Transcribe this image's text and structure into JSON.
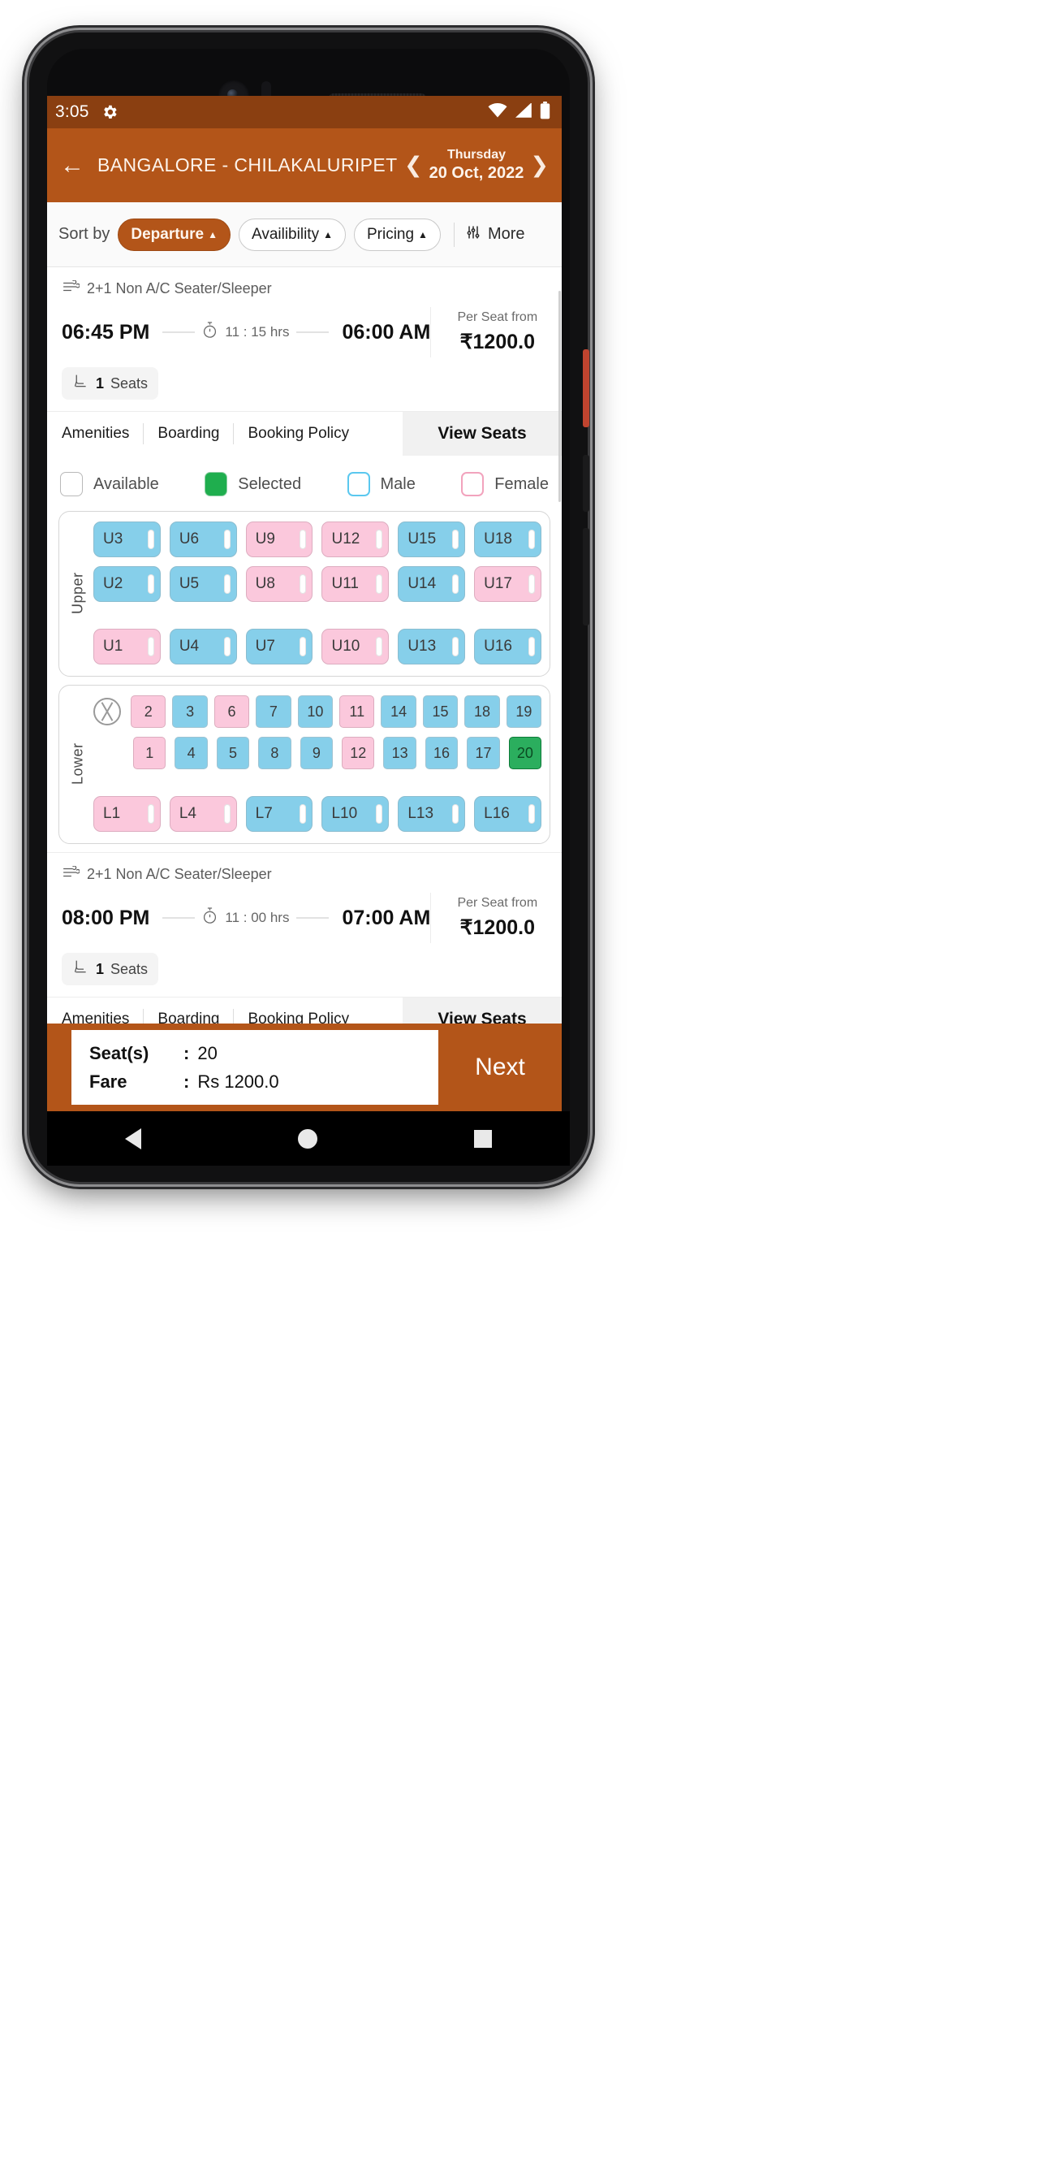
{
  "status_bar": {
    "time": "3:05",
    "gear_icon": "gear-icon",
    "wifi_icon": "wifi-icon",
    "signal_icon": "signal-icon",
    "battery_icon": "battery-icon"
  },
  "app_bar": {
    "back_icon": "arrow-left-icon",
    "route": "BANGALORE - CHILAKALURIPET",
    "prev_icon": "chevron-left-icon",
    "next_icon": "chevron-right-icon",
    "day_of_week": "Thursday",
    "date": "20 Oct, 2022"
  },
  "sort_bar": {
    "label": "Sort by",
    "chips": [
      {
        "label": "Departure",
        "caret": "▲",
        "active": true
      },
      {
        "label": "Availibility",
        "caret": "▲",
        "active": false
      },
      {
        "label": "Pricing",
        "caret": "▲",
        "active": false
      }
    ],
    "more_icon": "filter-icon",
    "more_label": "More"
  },
  "legend": {
    "items": [
      {
        "label": "Available",
        "state": "available"
      },
      {
        "label": "Selected",
        "state": "selected"
      },
      {
        "label": "Male",
        "state": "male"
      },
      {
        "label": "Female",
        "state": "female"
      }
    ]
  },
  "buses": [
    {
      "type_icon": "bus-seat-icon",
      "type": "2+1 Non A/C Seater/Sleeper",
      "departure": "06:45 PM",
      "duration_icon": "stopwatch-icon",
      "duration": "11 : 15 hrs",
      "arrival": "06:00 AM",
      "seat_icon": "seat-icon",
      "seats_count": "1",
      "seats_word": "Seats",
      "price_label": "Per Seat from",
      "price": "₹1200.0",
      "actions": [
        "Amenities",
        "Boarding",
        "Booking Policy"
      ],
      "view_seats": "View Seats",
      "expanded": true,
      "decks": [
        {
          "name": "Upper",
          "type": "sleeper",
          "rows": [
            [
              {
                "label": "U3",
                "color": "blue"
              },
              {
                "label": "U6",
                "color": "blue"
              },
              {
                "label": "U9",
                "color": "pink"
              },
              {
                "label": "U12",
                "color": "pink"
              },
              {
                "label": "U15",
                "color": "blue"
              },
              {
                "label": "U18",
                "color": "blue"
              }
            ],
            [
              {
                "label": "U2",
                "color": "blue"
              },
              {
                "label": "U5",
                "color": "blue"
              },
              {
                "label": "U8",
                "color": "pink"
              },
              {
                "label": "U11",
                "color": "pink"
              },
              {
                "label": "U14",
                "color": "blue"
              },
              {
                "label": "U17",
                "color": "pink"
              }
            ],
            [
              {
                "label": "U1",
                "color": "pink"
              },
              {
                "label": "U4",
                "color": "blue"
              },
              {
                "label": "U7",
                "color": "blue"
              },
              {
                "label": "U10",
                "color": "pink"
              },
              {
                "label": "U13",
                "color": "blue"
              },
              {
                "label": "U16",
                "color": "blue"
              }
            ]
          ]
        },
        {
          "name": "Lower",
          "type": "seater",
          "wheel_icon": "steering-wheel-icon",
          "rows": [
            [
              {
                "label": "2",
                "color": "pink"
              },
              {
                "label": "3",
                "color": "blue"
              },
              {
                "label": "6",
                "color": "pink"
              },
              {
                "label": "7",
                "color": "blue"
              },
              {
                "label": "10",
                "color": "blue"
              },
              {
                "label": "11",
                "color": "pink"
              },
              {
                "label": "14",
                "color": "blue"
              },
              {
                "label": "15",
                "color": "blue"
              },
              {
                "label": "18",
                "color": "blue"
              },
              {
                "label": "19",
                "color": "blue"
              }
            ],
            [
              {
                "label": "1",
                "color": "pink"
              },
              {
                "label": "4",
                "color": "blue"
              },
              {
                "label": "5",
                "color": "blue"
              },
              {
                "label": "8",
                "color": "blue"
              },
              {
                "label": "9",
                "color": "blue"
              },
              {
                "label": "12",
                "color": "pink"
              },
              {
                "label": "13",
                "color": "blue"
              },
              {
                "label": "16",
                "color": "blue"
              },
              {
                "label": "17",
                "color": "blue"
              },
              {
                "label": "20",
                "color": "green"
              }
            ]
          ],
          "berth_row": [
            {
              "label": "L1",
              "color": "pink"
            },
            {
              "label": "L4",
              "color": "pink"
            },
            {
              "label": "L7",
              "color": "blue"
            },
            {
              "label": "L10",
              "color": "blue"
            },
            {
              "label": "L13",
              "color": "blue"
            },
            {
              "label": "L16",
              "color": "blue"
            }
          ]
        }
      ]
    },
    {
      "type_icon": "bus-seat-icon",
      "type": "2+1 Non A/C Seater/Sleeper",
      "departure": "08:00 PM",
      "duration_icon": "stopwatch-icon",
      "duration": "11 : 00 hrs",
      "arrival": "07:00 AM",
      "seat_icon": "seat-icon",
      "seats_count": "1",
      "seats_word": "Seats",
      "price_label": "Per Seat from",
      "price": "₹1200.0",
      "actions": [
        "Amenities",
        "Boarding",
        "Booking Policy"
      ],
      "view_seats": "View Seats",
      "expanded": false
    }
  ],
  "bottom_bar": {
    "seats_key": "Seat(s)",
    "seats_sep": ":",
    "seats_value": "20",
    "fare_key": "Fare",
    "fare_sep": ":",
    "fare_value": "Rs 1200.0",
    "next_label": "Next"
  },
  "nav_bar": {
    "back_icon": "triangle-back-icon",
    "home_icon": "circle-home-icon",
    "recents_icon": "square-recents-icon"
  },
  "colors": {
    "brand": "#b35519",
    "status_bar": "#8a3f11",
    "selected_green": "#2BAE5E",
    "male_blue": "#86CFEA",
    "female_pink": "#FBC8DC"
  }
}
